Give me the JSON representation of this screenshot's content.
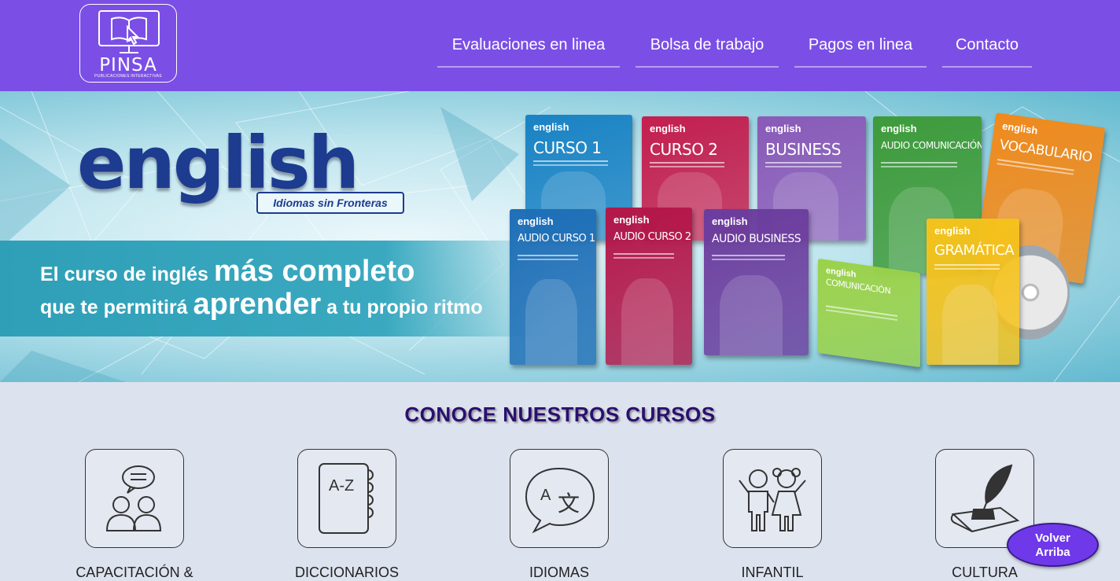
{
  "header": {
    "logo": {
      "brand": "PINSA",
      "subtitle": "PUBLICACIONES INTERACTIVAS"
    },
    "nav": [
      {
        "label": "Evaluaciones en linea"
      },
      {
        "label": "Bolsa de trabajo"
      },
      {
        "label": "Pagos en linea"
      },
      {
        "label": "Contacto"
      }
    ]
  },
  "banner": {
    "word": "english",
    "tagline": "Idiomas sin Fronteras",
    "slogan": {
      "line1_prefix": "El curso de inglés ",
      "line1_emph": "más completo",
      "line2_prefix": "que te permitirá ",
      "line2_emph": "aprender",
      "line2_suffix": " a tu propio ritmo"
    },
    "products": [
      {
        "brand": "english",
        "title": "CURSO 1",
        "color": "#1a83c4"
      },
      {
        "brand": "english",
        "title": "CURSO 2",
        "color": "#c41e4e"
      },
      {
        "brand": "english",
        "title": "BUSINESS",
        "color": "#8a5ab8"
      },
      {
        "brand": "english",
        "title": "AUDIO COMUNICACIÓN",
        "color": "#3e9b3a"
      },
      {
        "brand": "english",
        "title": "VOCABULARIO",
        "color": "#f08a1c"
      },
      {
        "brand": "english",
        "title": "AUDIO CURSO 1",
        "color": "#1f6fb7"
      },
      {
        "brand": "english",
        "title": "AUDIO CURSO 2",
        "color": "#b3174a"
      },
      {
        "brand": "english",
        "title": "AUDIO BUSINESS",
        "color": "#6b3d9e"
      },
      {
        "brand": "english",
        "title": "COMUNICACIÓN",
        "color": "#9ad24a"
      },
      {
        "brand": "english",
        "title": "GRAMÁTICA",
        "color": "#f5c21b"
      }
    ]
  },
  "courses": {
    "title": "CONOCE NUESTROS CURSOS",
    "items": [
      {
        "label": "CAPACITACIÓN &",
        "icon": "group-chat-icon"
      },
      {
        "label": "DICCIONARIOS",
        "icon": "a-z-book-icon"
      },
      {
        "label": "IDIOMAS",
        "icon": "translate-icon"
      },
      {
        "label": "INFANTIL",
        "icon": "children-icon"
      },
      {
        "label": "CULTURA",
        "icon": "quill-ink-icon"
      }
    ]
  },
  "back_to_top": {
    "line1": "Volver",
    "line2": "Arriba"
  }
}
